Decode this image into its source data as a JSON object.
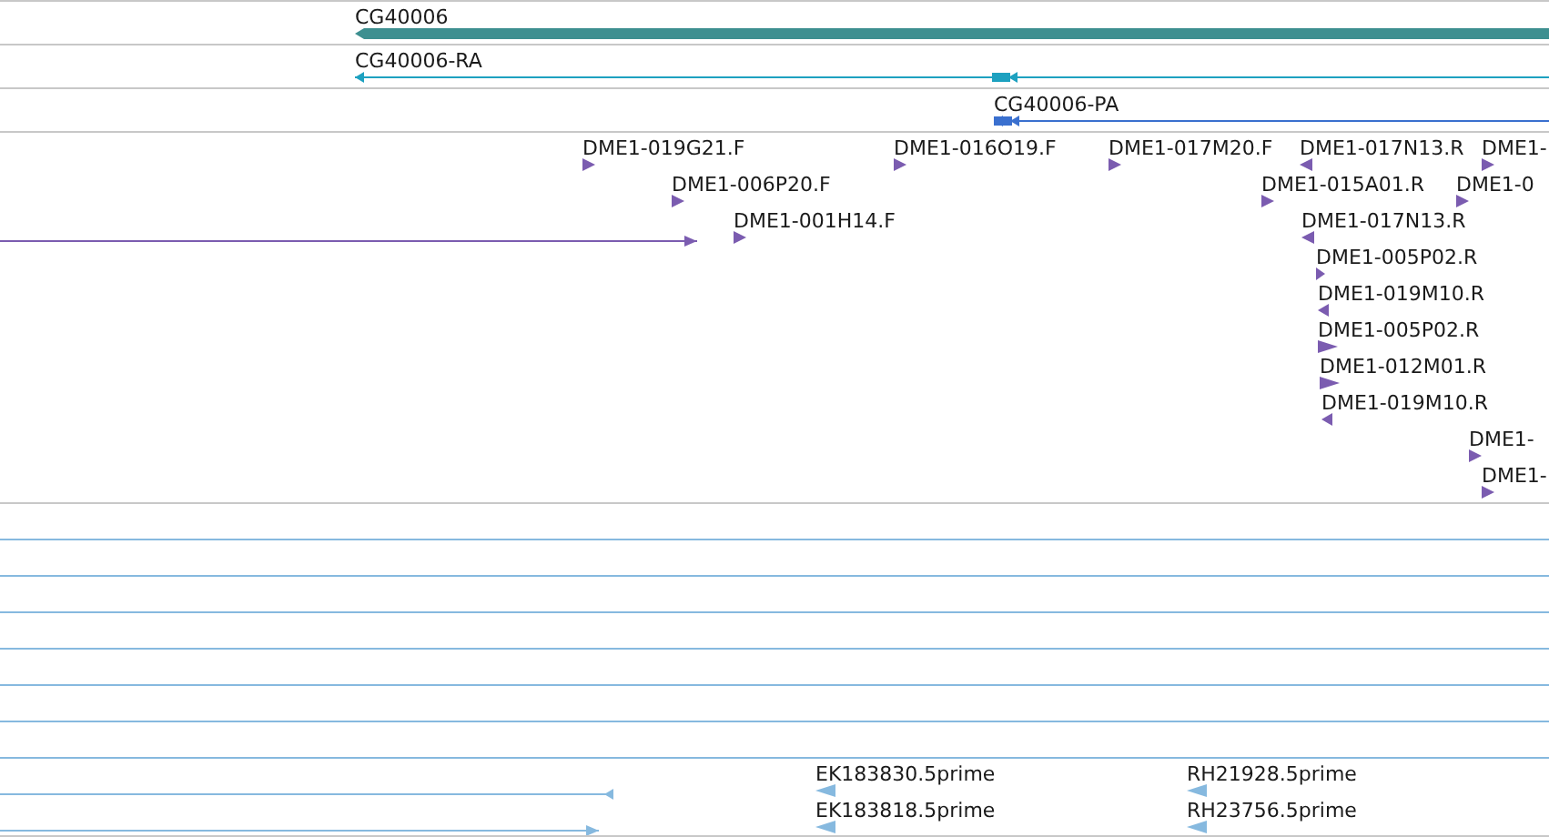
{
  "tracks": [
    {
      "kind": "gene",
      "features": [
        {
          "kind": "gene",
          "label": "CG40006",
          "reverse": true
        }
      ]
    },
    {
      "kind": "transcript",
      "features": [
        {
          "kind": "transcript",
          "label": "CG40006-RA",
          "reverse": true
        }
      ]
    },
    {
      "kind": "polypeptide",
      "features": [
        {
          "kind": "transcript",
          "label": "CG40006-PA",
          "reverse": true
        }
      ]
    },
    {
      "kind": "est",
      "features": [
        {
          "kind": "read",
          "label": "DME1-019G21.F",
          "reverse": false
        },
        {
          "kind": "read",
          "label": "DME1-016O19.F",
          "reverse": false
        },
        {
          "kind": "read",
          "label": "DME1-017M20.F",
          "reverse": false
        },
        {
          "kind": "read",
          "label": "DME1-017N13.R",
          "reverse": true
        },
        {
          "kind": "read",
          "label": "DME1-",
          "reverse": false
        },
        {
          "kind": "read",
          "label": "DME1-006P20.F",
          "reverse": false
        },
        {
          "kind": "read",
          "label": "DME1-015A01.R",
          "reverse": false
        },
        {
          "kind": "read",
          "label": "DME1-0",
          "reverse": false
        },
        {
          "kind": "span",
          "reverse": false
        },
        {
          "kind": "read",
          "label": "DME1-001H14.F",
          "reverse": false
        },
        {
          "kind": "read",
          "label": "DME1-017N13.R",
          "reverse": true
        },
        {
          "kind": "read",
          "label": "DME1-005P02.R",
          "reverse": false
        },
        {
          "kind": "read",
          "label": "DME1-019M10.R",
          "reverse": true
        },
        {
          "kind": "read",
          "label": "DME1-005P02.R",
          "reverse": false
        },
        {
          "kind": "read",
          "label": "DME1-012M01.R",
          "reverse": false
        },
        {
          "kind": "read",
          "label": "DME1-019M10.R",
          "reverse": true
        },
        {
          "kind": "read",
          "label": "DME1-",
          "reverse": false
        },
        {
          "kind": "read",
          "label": "DME1-",
          "reverse": false
        }
      ]
    },
    {
      "kind": "cdna",
      "features": [
        {
          "kind": "span"
        },
        {
          "kind": "span"
        },
        {
          "kind": "span"
        },
        {
          "kind": "span"
        },
        {
          "kind": "span"
        },
        {
          "kind": "span"
        },
        {
          "kind": "span"
        },
        {
          "kind": "span",
          "reverse": true
        },
        {
          "kind": "read",
          "label": "EK183830.5prime",
          "reverse": true
        },
        {
          "kind": "read",
          "label": "RH21928.5prime",
          "reverse": true
        },
        {
          "kind": "span",
          "reverse": false
        },
        {
          "kind": "read",
          "label": "EK183818.5prime",
          "reverse": true
        },
        {
          "kind": "read",
          "label": "RH23756.5prime",
          "reverse": true
        }
      ]
    }
  ]
}
